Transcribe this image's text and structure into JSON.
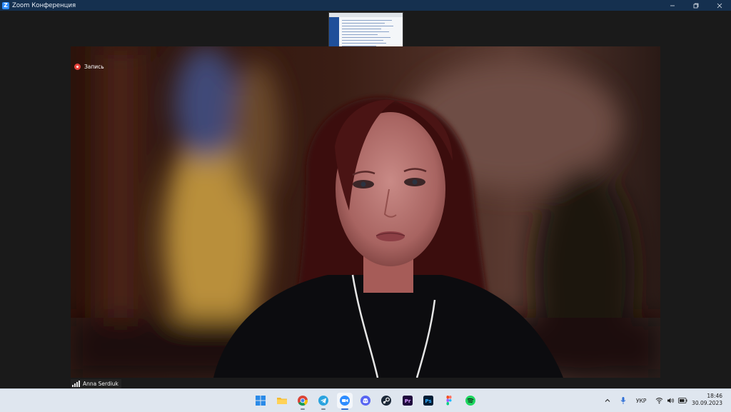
{
  "window": {
    "title": "Zoom Конференция"
  },
  "recording": {
    "label": "Запись"
  },
  "participant": {
    "name": "Anna Serdiuk"
  },
  "taskbar": {
    "apps": [
      {
        "name": "start-icon"
      },
      {
        "name": "file-explorer-icon"
      },
      {
        "name": "chrome-icon"
      },
      {
        "name": "telegram-icon"
      },
      {
        "name": "zoom-icon",
        "active": true
      },
      {
        "name": "discord-icon"
      },
      {
        "name": "steam-icon"
      },
      {
        "name": "premiere-pro-icon",
        "text": "Pr"
      },
      {
        "name": "photoshop-icon",
        "text": "Ps"
      },
      {
        "name": "figma-icon"
      },
      {
        "name": "spotify-icon"
      }
    ],
    "tray": {
      "language": "УКР",
      "time": "18:46",
      "date": "30.09.2023"
    }
  },
  "colors": {
    "titlebar": "#15304f",
    "zoom_blue": "#2d8cff",
    "record_red": "#e8423b"
  }
}
